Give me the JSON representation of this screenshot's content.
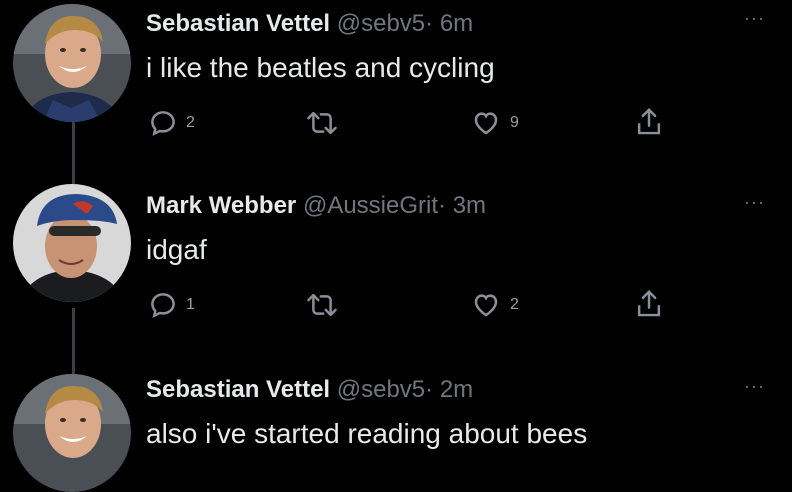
{
  "tweets": [
    {
      "name": "Sebastian Vettel",
      "handle": "@sebv5",
      "separator": "·",
      "time": "6m",
      "text": "i like the beatles and cycling",
      "replies": "2",
      "retweets": "",
      "likes": "9"
    },
    {
      "name": "Mark Webber",
      "handle": "@AussieGrit",
      "separator": "·",
      "time": "3m",
      "text": "idgaf",
      "replies": "1",
      "retweets": "",
      "likes": "2"
    },
    {
      "name": "Sebastian Vettel",
      "handle": "@sebv5",
      "separator": "·",
      "time": "2m",
      "text": "also i've started reading about bees"
    }
  ],
  "more_label": "···",
  "colors": {
    "background": "#000000",
    "primary_text": "#e7e9ea",
    "secondary_text": "#71767b",
    "thread_line": "#3b3f44"
  },
  "icons": [
    "reply-icon",
    "retweet-icon",
    "like-icon",
    "share-icon",
    "more-icon"
  ]
}
